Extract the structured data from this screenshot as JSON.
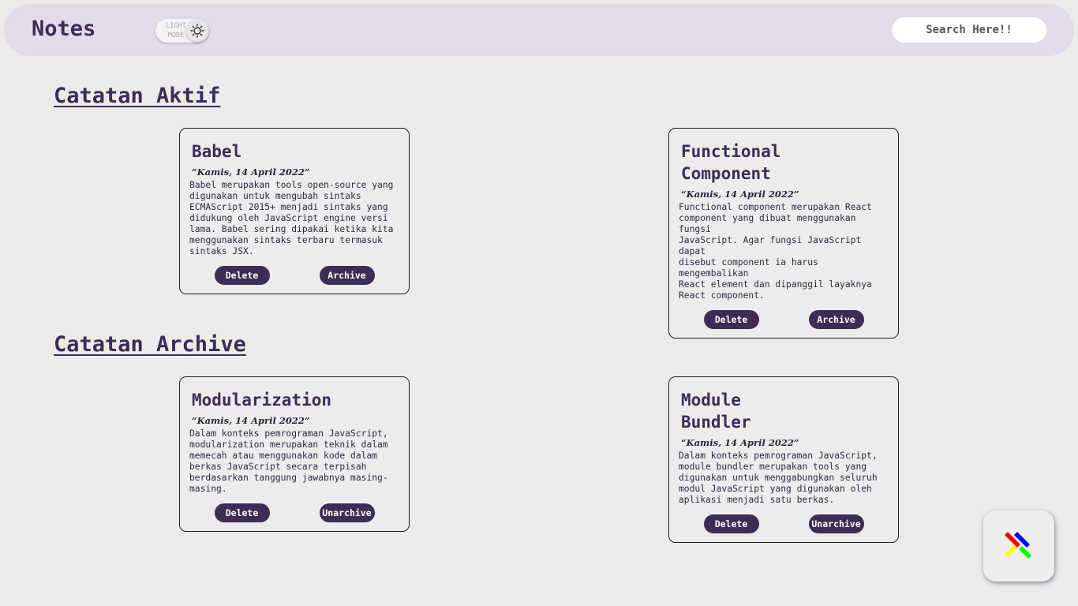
{
  "navbar": {
    "title": "Notes",
    "theme_toggle_label": "LIGHT MODE",
    "theme_icon": "sun-icon",
    "search_placeholder": "Search Here!!"
  },
  "sections": {
    "active_title": "Catatan Aktif",
    "archive_title": "Catatan Archive"
  },
  "active_notes": [
    {
      "title": "Babel",
      "date": "“Kamis, 14 April 2022”",
      "body": "Babel merupakan tools open-source yang\ndigunakan untuk mengubah sintaks\nECMAScript 2015+ menjadi sintaks yang\ndidukung oleh JavaScript engine versi\nlama. Babel sering dipakai ketika kita\nmenggunakan sintaks terbaru termasuk\nsintaks JSX.",
      "delete_label": "Delete",
      "archive_label": "Archive"
    },
    {
      "title": "Functional\nComponent",
      "date": "“Kamis, 14 April 2022”",
      "body": "Functional component merupakan React\ncomponent yang dibuat menggunakan fungsi\nJavaScript. Agar fungsi JavaScript dapat\ndisebut component ia harus mengembalikan\nReact element dan dipanggil layaknya\nReact component.",
      "delete_label": "Delete",
      "archive_label": "Archive"
    }
  ],
  "archived_notes": [
    {
      "title": "Modularization",
      "date": "“Kamis, 14 April 2022”",
      "body": "Dalam konteks pemrograman JavaScript,\nmodularization merupakan teknik dalam\nmemecah atau menggunakan kode dalam\nberkas JavaScript secara terpisah\nberdasarkan tanggung jawabnya masing-\nmasing.",
      "delete_label": "Delete",
      "unarchive_label": "Unarchive"
    },
    {
      "title": "Module\nBundler",
      "date": "“Kamis, 14 April 2022”",
      "body": "Dalam konteks pemrograman JavaScript,\nmodule bundler merupakan tools yang\ndigunakan untuk menggabungkan seluruh\nmodul JavaScript yang digunakan oleh\naplikasi menjadi satu berkas.",
      "delete_label": "Delete",
      "unarchive_label": "Unarchive"
    }
  ],
  "fab": {
    "icon": "add-note-icon",
    "colors": [
      "#ff0000",
      "#0000ff",
      "#ffff00",
      "#00ff00"
    ]
  },
  "colors": {
    "accent": "#3d2d55",
    "navbar_bg": "#e2dbea",
    "page_bg": "#ebebeb"
  }
}
